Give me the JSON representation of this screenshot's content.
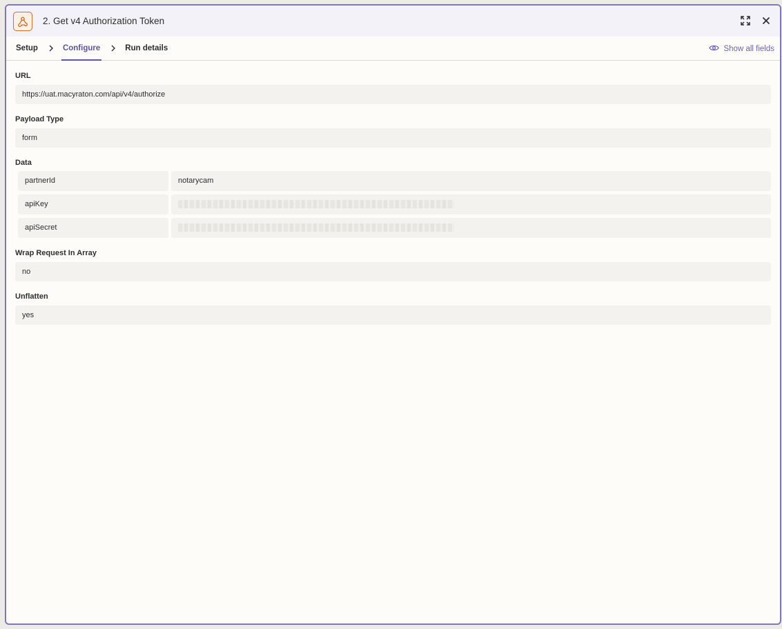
{
  "header": {
    "title": "2. Get v4 Authorization Token",
    "app_icon": "webhook-icon",
    "expand_icon": "expand-icon",
    "close_icon": "close-icon"
  },
  "tabs": [
    {
      "label": "Setup",
      "active": false
    },
    {
      "label": "Configure",
      "active": true
    },
    {
      "label": "Run details",
      "active": false
    }
  ],
  "show_all_fields": {
    "label": "Show all fields",
    "icon": "eye-icon"
  },
  "fields": {
    "url": {
      "label": "URL",
      "value": "https://uat.macyraton.com/api/v4/authorize"
    },
    "payload_type": {
      "label": "Payload Type",
      "value": "form"
    },
    "data": {
      "label": "Data",
      "rows": [
        {
          "key": "partnerId",
          "value": "notarycam",
          "redacted": false
        },
        {
          "key": "apiKey",
          "value": "",
          "redacted": true
        },
        {
          "key": "apiSecret",
          "value": "",
          "redacted": true
        }
      ]
    },
    "wrap_request": {
      "label": "Wrap Request In Array",
      "value": "no"
    },
    "unflatten": {
      "label": "Unflatten",
      "value": "yes"
    }
  },
  "colors": {
    "accent": "#5c55a6",
    "app_icon_border": "#d46a2d",
    "panel_border": "#7e78b8"
  }
}
